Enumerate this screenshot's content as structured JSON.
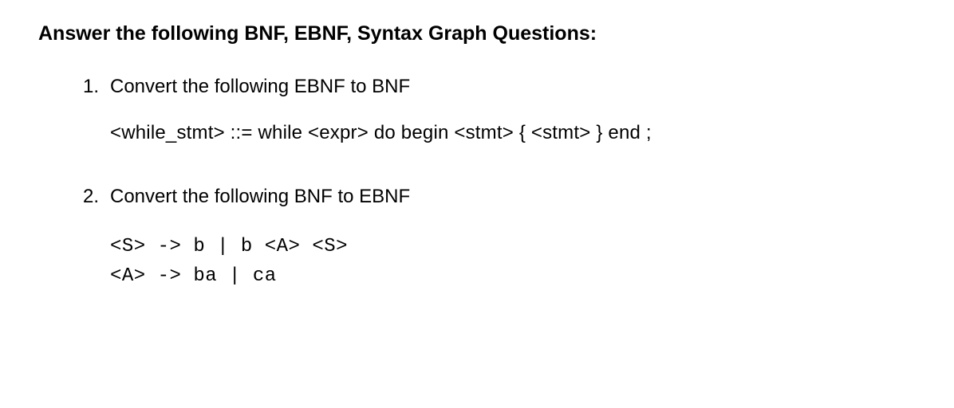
{
  "heading": "Answer the following BNF, EBNF, Syntax Graph Questions:",
  "q1": {
    "number": "1.",
    "prompt": "Convert the following EBNF to BNF",
    "grammar": "<while_stmt> ::= while <expr> do begin <stmt> { <stmt> } end ;"
  },
  "q2": {
    "number": "2.",
    "prompt": "Convert the following BNF to EBNF",
    "code_line1": "<S> -> b | b <A> <S>",
    "code_line2": "<A> -> ba | ca"
  }
}
